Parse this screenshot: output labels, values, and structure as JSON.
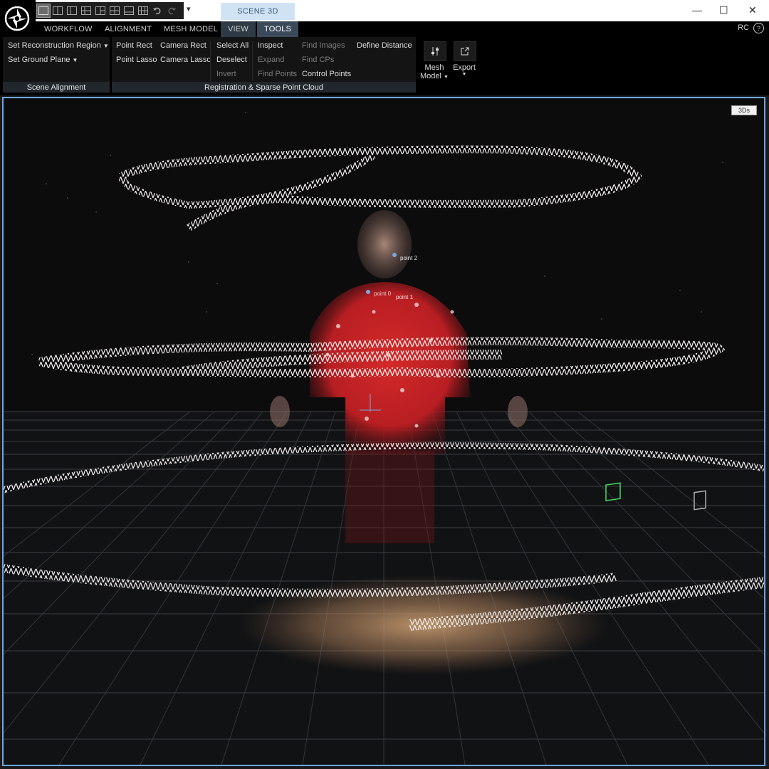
{
  "window": {
    "scene_tab": "SCENE 3D",
    "qat_dropdown_glyph": "▾",
    "controls": [
      "—",
      "☐",
      "✕"
    ]
  },
  "ribbon_tabs": {
    "workflow": "WORKFLOW",
    "alignment": "ALIGNMENT",
    "mesh_model": "MESH MODEL",
    "view": "VIEW",
    "tools": "TOOLS",
    "user_badge": "RC",
    "help": "?"
  },
  "groups": {
    "scene_alignment": {
      "title": "Scene Alignment",
      "items": [
        "Set Reconstruction Region",
        "Set Ground Plane"
      ]
    },
    "registration": {
      "title": "Registration & Sparse Point Cloud",
      "col1": [
        "Point Rect",
        "Point Lasso"
      ],
      "col2": [
        "Camera Rect",
        "Camera Lasso"
      ],
      "col3": [
        "Select All",
        "Deselect",
        "Invert"
      ],
      "col4": [
        "Inspect",
        "Expand",
        "Find Points"
      ],
      "col5": [
        "Find Images",
        "Find CPs",
        "Control Points"
      ],
      "col6": [
        "Define Distance"
      ]
    },
    "mesh_model_btn": {
      "line1": "Mesh",
      "line2": "Model"
    },
    "export_btn": {
      "label": "Export"
    }
  },
  "viewport": {
    "badge": "3Ds",
    "points": [
      "point 2",
      "point 0",
      "point 1"
    ]
  },
  "colors": {
    "accent_blue": "#6aa6e2",
    "tools_tab": "#3b4a5a",
    "scene_tab_bg": "#cfe3f5"
  }
}
